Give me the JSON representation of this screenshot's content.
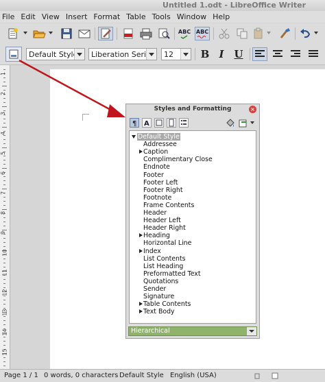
{
  "window": {
    "title": "Untitled 1.odt - LibreOffice Writer"
  },
  "menu": [
    "File",
    "Edit",
    "View",
    "Insert",
    "Format",
    "Table",
    "Tools",
    "Window",
    "Help"
  ],
  "toolbar": {
    "paragraph_style": "Default Style",
    "font_name": "Liberation Serif",
    "font_size": "12",
    "bold": "B",
    "italic": "I",
    "underline": "U",
    "spellcheck_label": "ABC",
    "autospell_label": "ABC"
  },
  "styles_panel": {
    "title": "Styles and Formatting",
    "items": [
      {
        "label": "Default Style",
        "level": 0,
        "expander": "down",
        "selected": true
      },
      {
        "label": "Addressee",
        "level": 1
      },
      {
        "label": "Caption",
        "level": 1,
        "expander": "right"
      },
      {
        "label": "Complimentary Close",
        "level": 1
      },
      {
        "label": "Endnote",
        "level": 1
      },
      {
        "label": "Footer",
        "level": 1
      },
      {
        "label": "Footer Left",
        "level": 1
      },
      {
        "label": "Footer Right",
        "level": 1
      },
      {
        "label": "Footnote",
        "level": 1
      },
      {
        "label": "Frame Contents",
        "level": 1
      },
      {
        "label": "Header",
        "level": 1
      },
      {
        "label": "Header Left",
        "level": 1
      },
      {
        "label": "Header Right",
        "level": 1
      },
      {
        "label": "Heading",
        "level": 1,
        "expander": "right"
      },
      {
        "label": "Horizontal Line",
        "level": 1
      },
      {
        "label": "Index",
        "level": 1,
        "expander": "right"
      },
      {
        "label": "List Contents",
        "level": 1
      },
      {
        "label": "List Heading",
        "level": 1
      },
      {
        "label": "Preformatted Text",
        "level": 1
      },
      {
        "label": "Quotations",
        "level": 1
      },
      {
        "label": "Sender",
        "level": 1
      },
      {
        "label": "Signature",
        "level": 1
      },
      {
        "label": "Table Contents",
        "level": 1,
        "expander": "right"
      },
      {
        "label": "Text Body",
        "level": 1,
        "expander": "right"
      }
    ],
    "filter": "Hierarchical"
  },
  "ruler_numbers": [
    "1",
    "2",
    "3",
    "4",
    "5",
    "6",
    "7",
    "8",
    "9",
    "10",
    "11",
    "12",
    "13",
    "14",
    "15"
  ],
  "status": {
    "page": "Page 1 / 1",
    "words": "0 words, 0 characters",
    "style": "Default Style",
    "language": "English (USA)"
  },
  "colors": {
    "arrow": "#c0151c",
    "filter_bg": "#8fb36a",
    "close": "#d84040"
  }
}
